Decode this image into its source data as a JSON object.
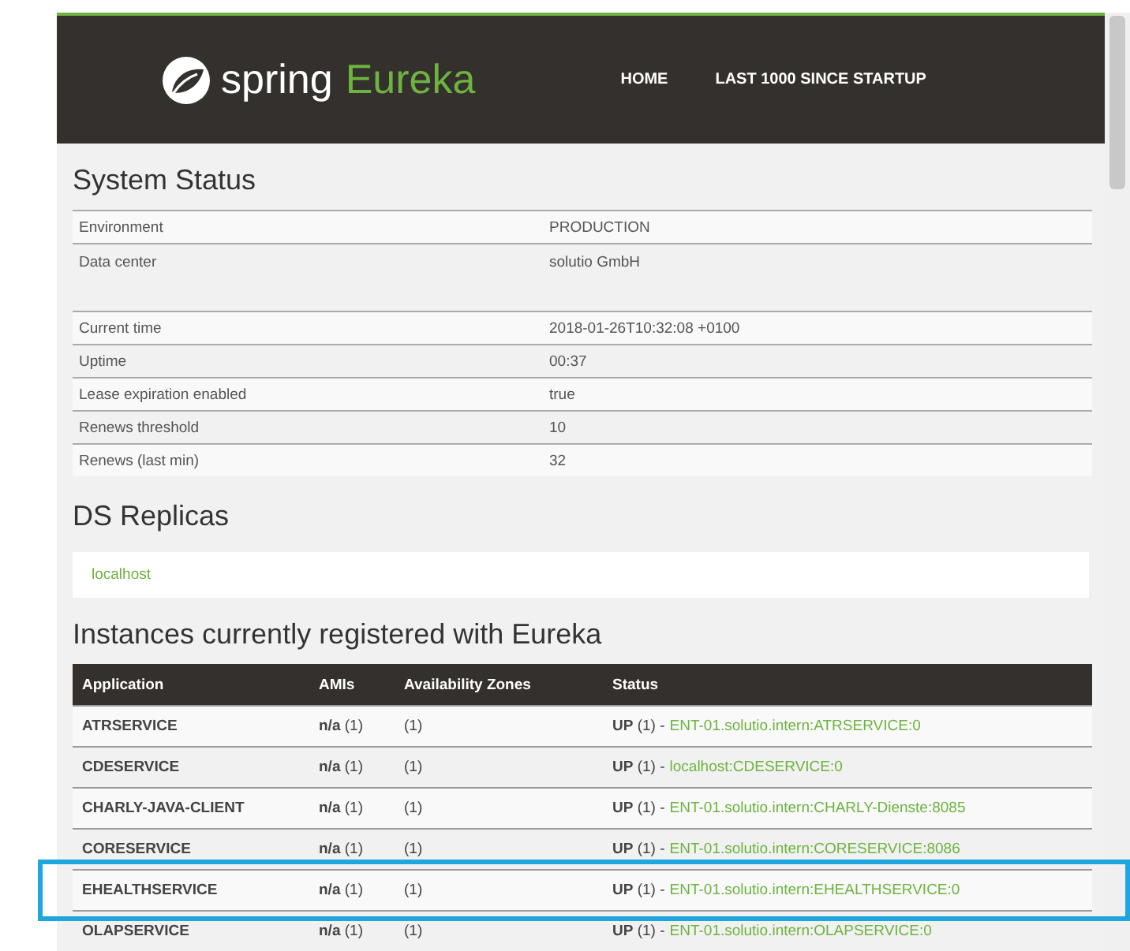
{
  "header": {
    "brand": "spring",
    "product": "Eureka",
    "nav": [
      {
        "label": "HOME"
      },
      {
        "label": "LAST 1000 SINCE STARTUP"
      }
    ]
  },
  "system_status": {
    "title": "System Status",
    "groups": [
      [
        {
          "label": "Environment",
          "value": "PRODUCTION"
        },
        {
          "label": "Data center",
          "value": "solutio GmbH"
        }
      ],
      [
        {
          "label": "Current time",
          "value": "2018-01-26T10:32:08 +0100"
        },
        {
          "label": "Uptime",
          "value": "00:37"
        },
        {
          "label": "Lease expiration enabled",
          "value": "true"
        },
        {
          "label": "Renews threshold",
          "value": "10"
        },
        {
          "label": "Renews (last min)",
          "value": "32"
        }
      ]
    ]
  },
  "replicas": {
    "title": "DS Replicas",
    "items": [
      "localhost"
    ]
  },
  "instances": {
    "title": "Instances currently registered with Eureka",
    "columns": [
      "Application",
      "AMIs",
      "Availability Zones",
      "Status"
    ],
    "rows": [
      {
        "application": "ATRSERVICE",
        "amis": "**n/a** (1)",
        "zones": "(1)",
        "status": "**UP** (1) -",
        "instance": "ENT-01.solutio.intern:ATRSERVICE:0",
        "highlighted": false
      },
      {
        "application": "CDESERVICE",
        "amis": "**n/a** (1)",
        "zones": "(1)",
        "status": "**UP** (1) -",
        "instance": "localhost:CDESERVICE:0",
        "highlighted": false
      },
      {
        "application": "CHARLY-JAVA-CLIENT",
        "amis": "**n/a** (1)",
        "zones": "(1)",
        "status": "**UP** (1) -",
        "instance": "ENT-01.solutio.intern:CHARLY-Dienste:8085",
        "highlighted": false
      },
      {
        "application": "CORESERVICE",
        "amis": "**n/a** (1)",
        "zones": "(1)",
        "status": "**UP** (1) -",
        "instance": "ENT-01.solutio.intern:CORESERVICE:8086",
        "highlighted": false
      },
      {
        "application": "EHEALTHSERVICE",
        "amis": "**n/a** (1)",
        "zones": "(1)",
        "status": "**UP** (1) -",
        "instance": "ENT-01.solutio.intern:EHEALTHSERVICE:0",
        "highlighted": true
      },
      {
        "application": "OLAPSERVICE",
        "amis": "**n/a** (1)",
        "zones": "(1)",
        "status": "**UP** (1) -",
        "instance": "ENT-01.solutio.intern:OLAPSERVICE:0",
        "highlighted": false
      }
    ]
  }
}
